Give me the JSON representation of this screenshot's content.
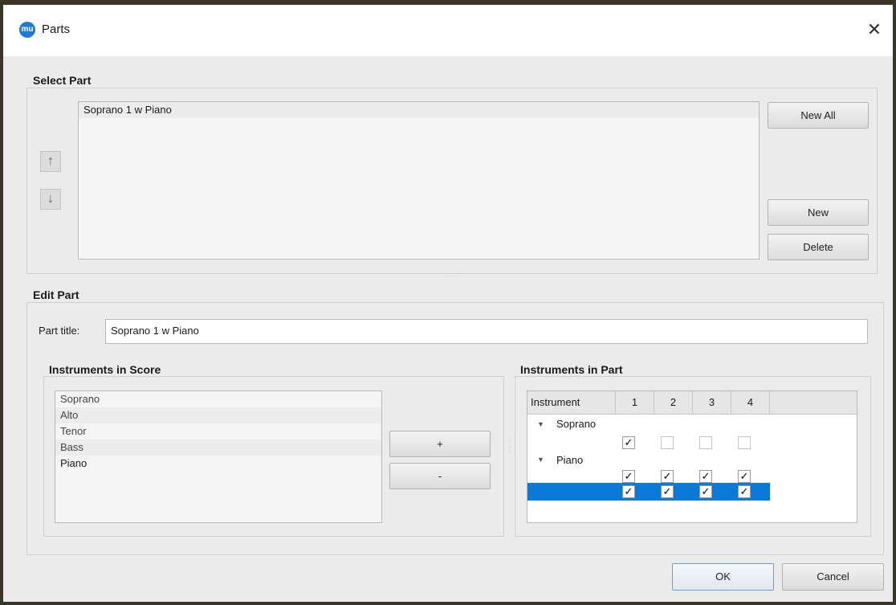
{
  "window": {
    "title": "Parts",
    "app_icon_text": "mu",
    "close_glyph": "✕"
  },
  "select_part": {
    "group_label": "Select Part",
    "parts": [
      "Soprano 1 w Piano"
    ],
    "move_up_glyph": "↑",
    "move_down_glyph": "↓",
    "new_all_label": "New All",
    "new_label": "New",
    "delete_label": "Delete"
  },
  "edit_part": {
    "group_label": "Edit Part",
    "part_title_label": "Part title:",
    "part_title_value": "Soprano 1 w Piano"
  },
  "instruments_in_score": {
    "group_label": "Instruments in Score",
    "items": [
      "Soprano",
      "Alto",
      "Tenor",
      "Bass",
      "Piano"
    ],
    "add_label": "+",
    "remove_label": "-"
  },
  "instruments_in_part": {
    "group_label": "Instruments in Part",
    "columns": [
      "Instrument",
      "1",
      "2",
      "3",
      "4"
    ],
    "instruments": [
      {
        "name": "Soprano",
        "staves": [
          [
            true,
            false,
            false,
            false
          ]
        ]
      },
      {
        "name": "Piano",
        "staves": [
          [
            true,
            true,
            true,
            true
          ],
          [
            true,
            true,
            true,
            true
          ]
        ]
      }
    ],
    "selected_row_color": "#0a78d7",
    "expand_glyph": "▼",
    "check_glyph": "✓"
  },
  "footer": {
    "ok_label": "OK",
    "cancel_label": "Cancel"
  }
}
